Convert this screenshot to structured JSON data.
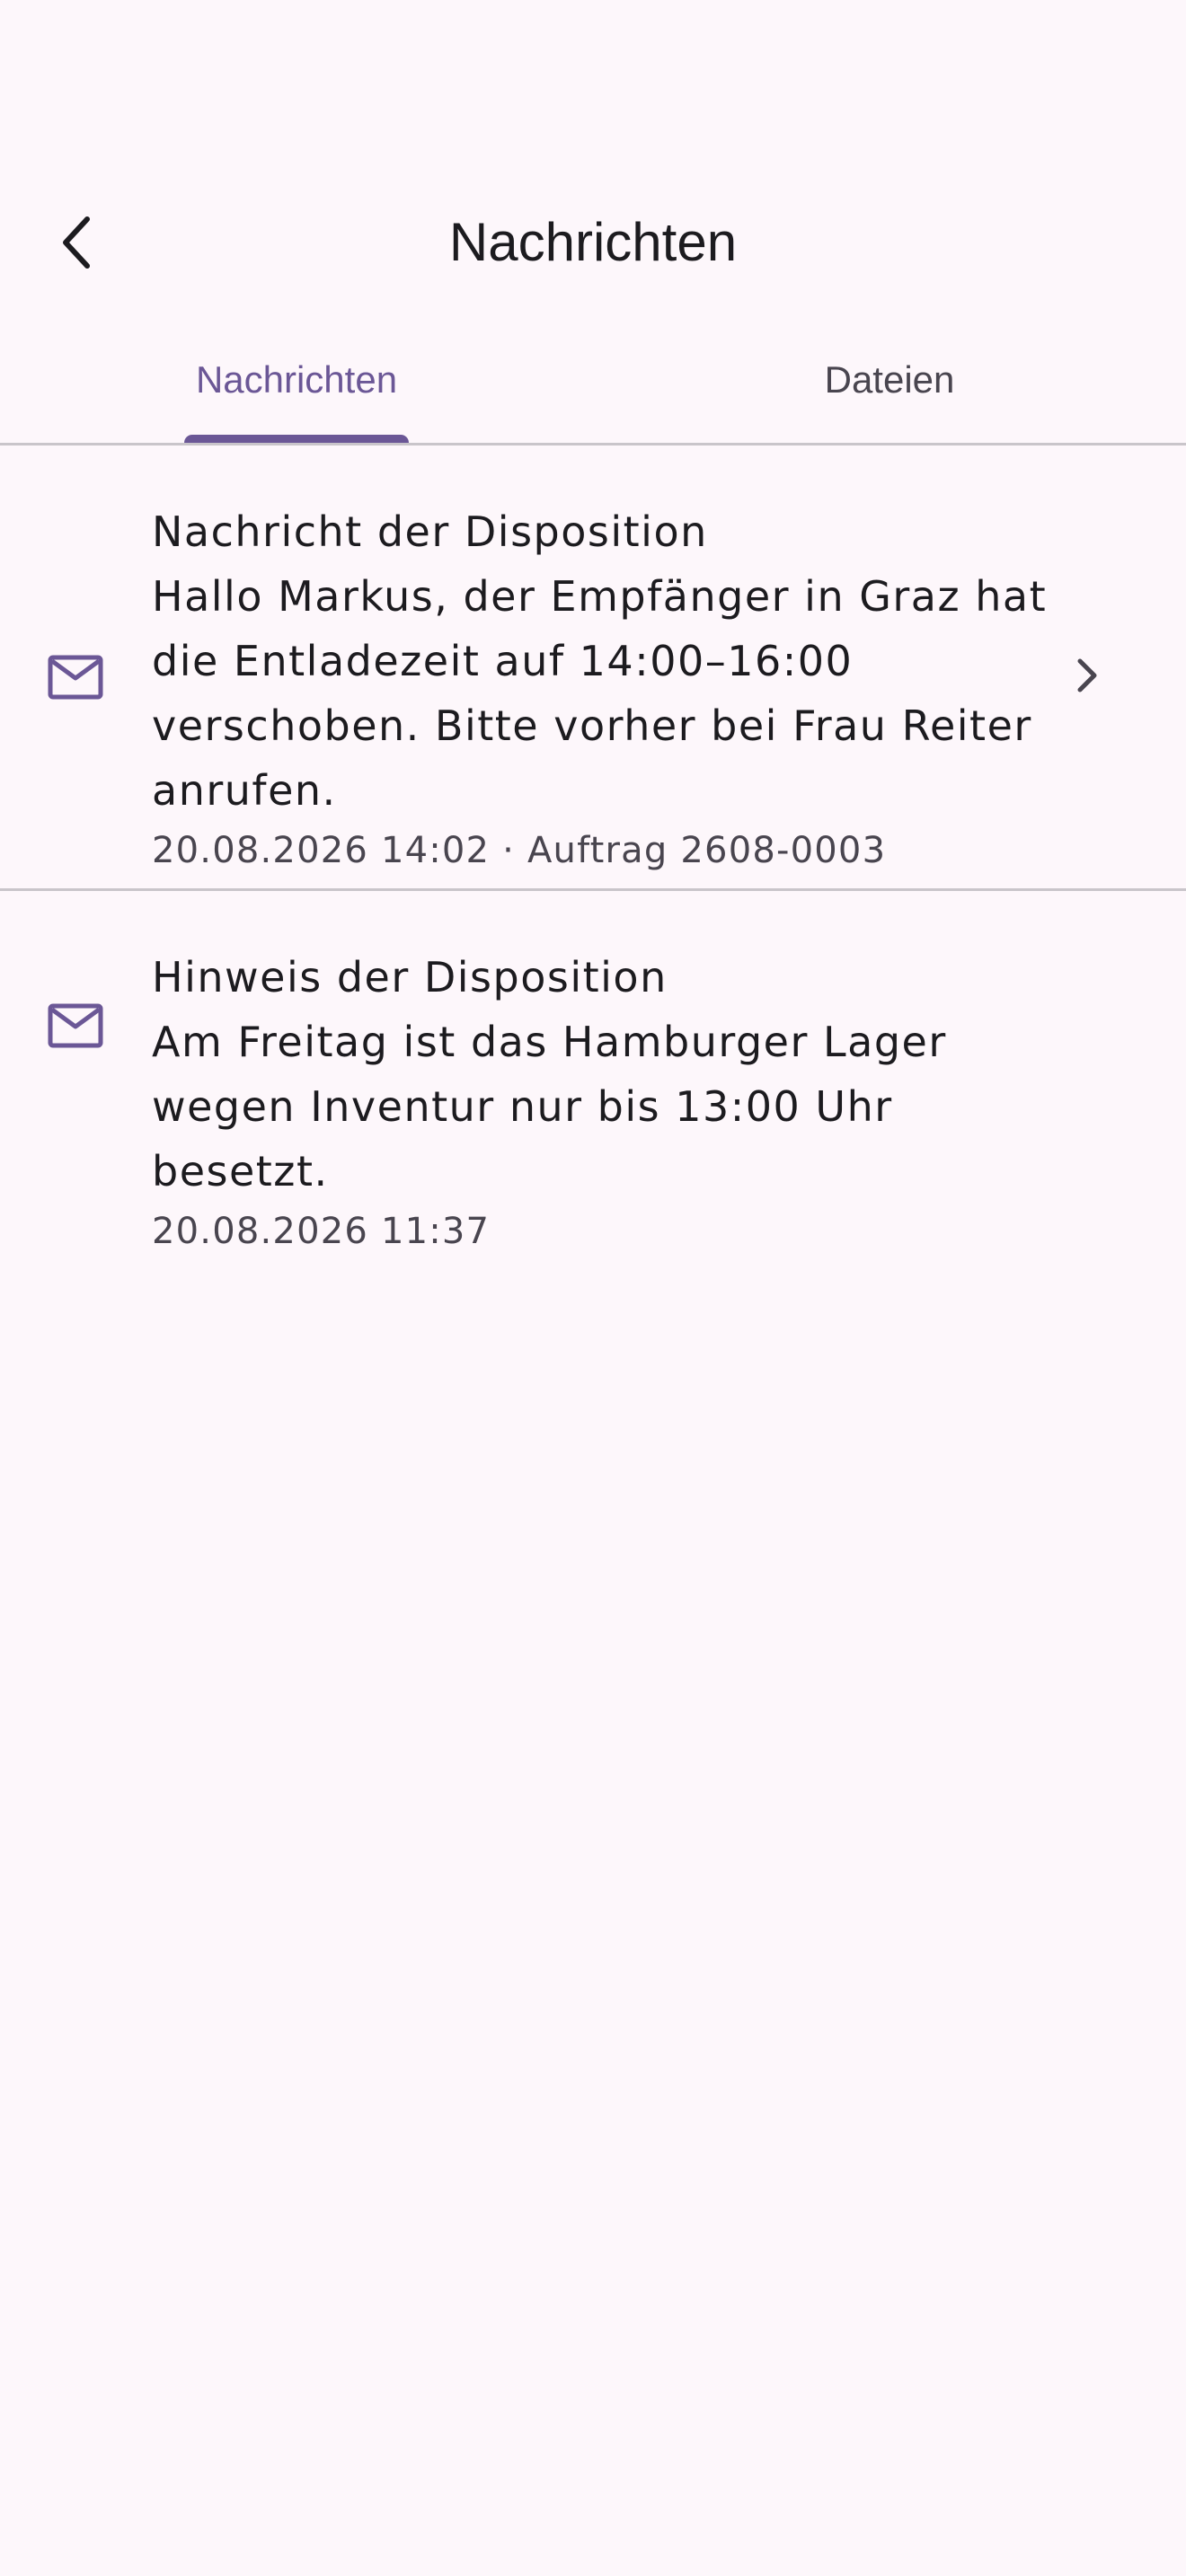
{
  "header": {
    "title": "Nachrichten",
    "back_icon": "chevron-left-icon"
  },
  "tabs": [
    {
      "label": "Nachrichten",
      "active": true
    },
    {
      "label": "Dateien",
      "active": false
    }
  ],
  "messages": [
    {
      "icon": "mail-icon",
      "title": "Nachricht der Disposition",
      "body": "Hallo Markus, der Empfänger in Graz hat die Entladezeit auf 14:00–16:00 verschoben. Bitte vorher bei Frau Reiter anrufen.",
      "meta": "20.08.2026 14:02 · Auftrag 2608-0003",
      "has_chevron": true
    },
    {
      "icon": "mail-icon",
      "title": "Hinweis der Disposition",
      "body": "Am Freitag ist das Hamburger Lager wegen Inventur nur bis 13:00 Uhr besetzt.",
      "meta": "20.08.2026 11:37",
      "has_chevron": false
    }
  ],
  "colors": {
    "background": "#fdf7fb",
    "accent": "#6b5796",
    "divider": "#c9c5ca",
    "text_primary": "#1c1b1f",
    "text_secondary": "#49454f"
  }
}
